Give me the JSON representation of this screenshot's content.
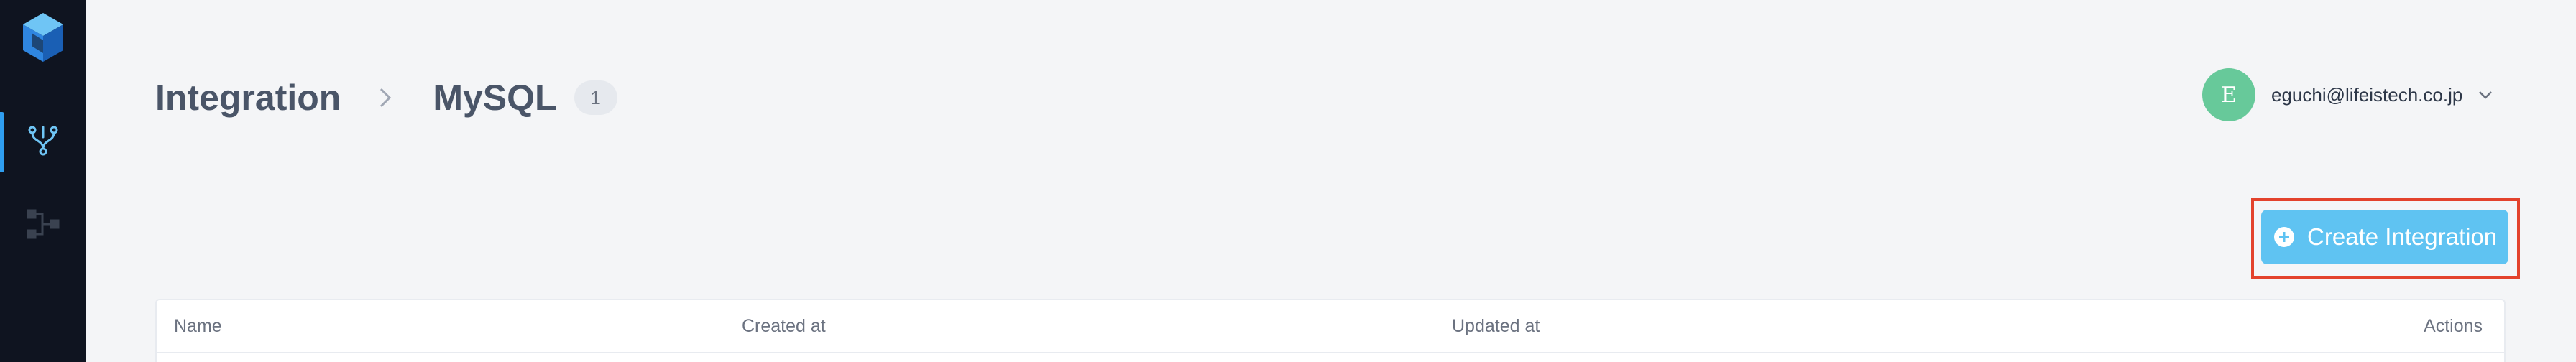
{
  "sidebar": {
    "logo": "app-logo",
    "items": [
      {
        "icon": "integration-icon",
        "active": true
      },
      {
        "icon": "pipeline-icon",
        "active": false
      }
    ]
  },
  "header": {
    "breadcrumb": [
      "Integration",
      "MySQL"
    ],
    "count": "1"
  },
  "user": {
    "initial": "E",
    "email": "eguchi@lifeistech.co.jp"
  },
  "toolbar": {
    "create_label": "Create Integration"
  },
  "table": {
    "columns": [
      "Name",
      "Created at",
      "Updated at",
      "Actions"
    ]
  },
  "colors": {
    "sidebar_bg": "#0f1420",
    "accent": "#2f9ef0",
    "button": "#5fc3f2",
    "avatar": "#67c99a",
    "highlight": "#e3422c"
  }
}
